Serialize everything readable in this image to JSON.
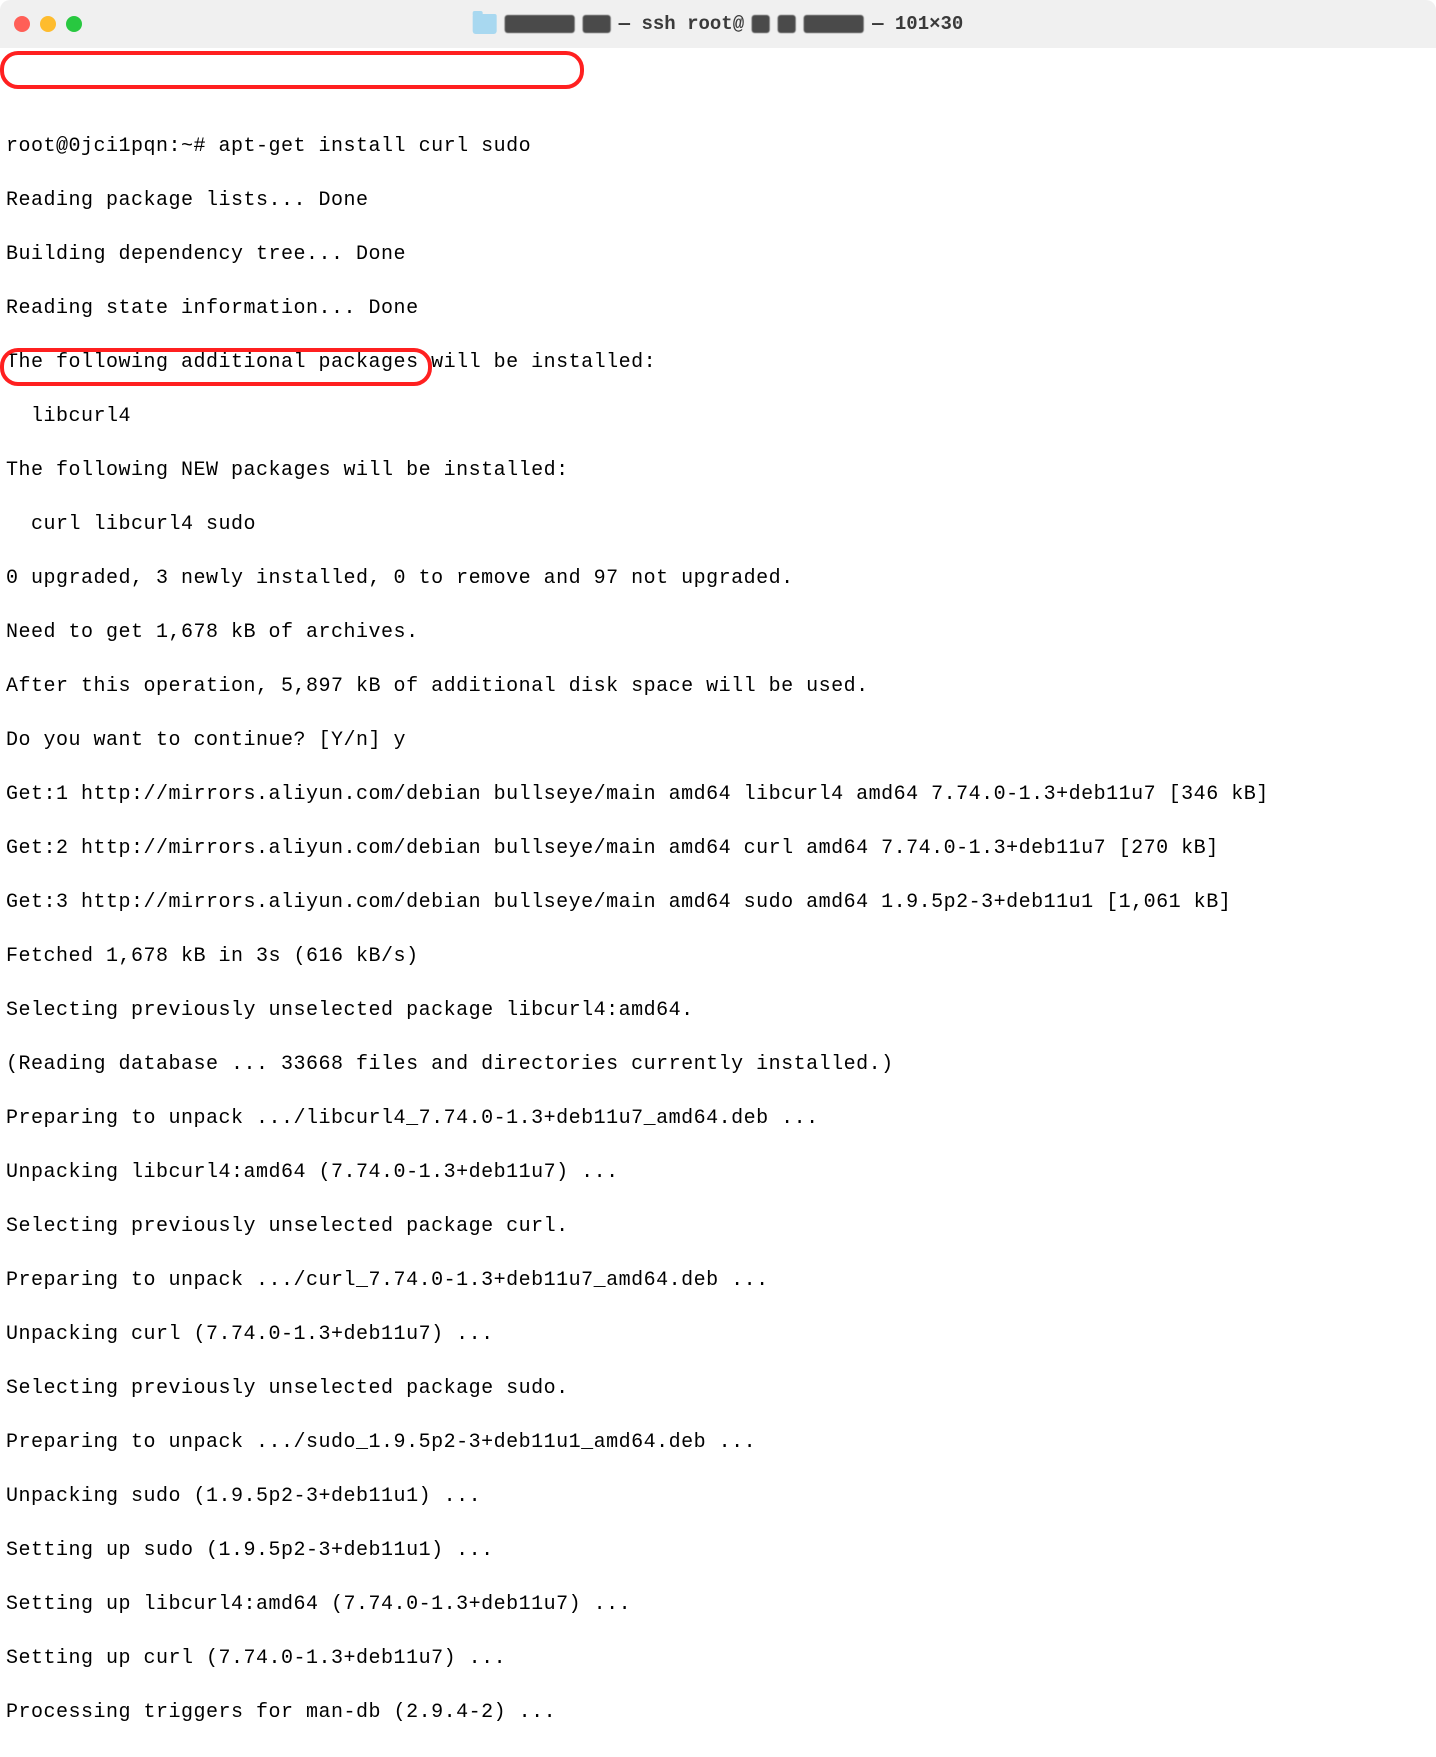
{
  "titlebar": {
    "title_prefix": "— ssh root@",
    "title_suffix": " — 101×30"
  },
  "terminal": {
    "lines": [
      "root@0jci1pqn:~# apt-get install curl sudo",
      "Reading package lists... Done",
      "Building dependency tree... Done",
      "Reading state information... Done",
      "The following additional packages will be installed:",
      "  libcurl4",
      "The following NEW packages will be installed:",
      "  curl libcurl4 sudo",
      "0 upgraded, 3 newly installed, 0 to remove and 97 not upgraded.",
      "Need to get 1,678 kB of archives.",
      "After this operation, 5,897 kB of additional disk space will be used.",
      "Do you want to continue? [Y/n] y",
      "Get:1 http://mirrors.aliyun.com/debian bullseye/main amd64 libcurl4 amd64 7.74.0-1.3+deb11u7 [346 kB]",
      "Get:2 http://mirrors.aliyun.com/debian bullseye/main amd64 curl amd64 7.74.0-1.3+deb11u7 [270 kB]",
      "Get:3 http://mirrors.aliyun.com/debian bullseye/main amd64 sudo amd64 1.9.5p2-3+deb11u1 [1,061 kB]",
      "Fetched 1,678 kB in 3s (616 kB/s)",
      "Selecting previously unselected package libcurl4:amd64.",
      "(Reading database ... 33668 files and directories currently installed.)",
      "Preparing to unpack .../libcurl4_7.74.0-1.3+deb11u7_amd64.deb ...",
      "Unpacking libcurl4:amd64 (7.74.0-1.3+deb11u7) ...",
      "Selecting previously unselected package curl.",
      "Preparing to unpack .../curl_7.74.0-1.3+deb11u7_amd64.deb ...",
      "Unpacking curl (7.74.0-1.3+deb11u7) ...",
      "Selecting previously unselected package sudo.",
      "Preparing to unpack .../sudo_1.9.5p2-3+deb11u1_amd64.deb ...",
      "Unpacking sudo (1.9.5p2-3+deb11u1) ...",
      "Setting up sudo (1.9.5p2-3+deb11u1) ...",
      "Setting up libcurl4:amd64 (7.74.0-1.3+deb11u7) ...",
      "Setting up curl (7.74.0-1.3+deb11u7) ...",
      "Processing triggers for man-db (2.9.4-2) ..."
    ]
  },
  "annotations": {
    "highlight1_target": "command-line",
    "highlight2_target": "confirm-prompt"
  }
}
